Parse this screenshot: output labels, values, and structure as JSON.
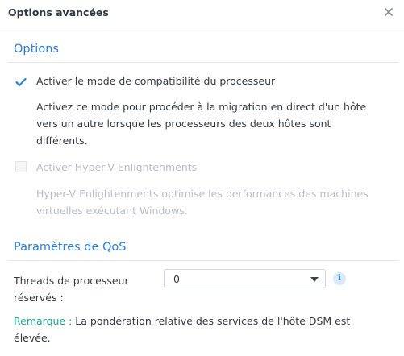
{
  "dialog": {
    "title": "Options avancées",
    "close_icon": "close-icon"
  },
  "options_section": {
    "title": "Options",
    "cpu_compat": {
      "label": "Activer le mode de compatibilité du processeur",
      "checked": true,
      "enabled": true,
      "description_lines": [
        "Activez ce mode pour procéder à la migration en direct d'un hôte",
        "vers un autre lorsque les processeurs des deux hôtes sont",
        "différents."
      ]
    },
    "hyperv": {
      "label": "Activer Hyper-V Enlightenments",
      "checked": false,
      "enabled": false,
      "description_lines": [
        "Hyper-V Enlightenments optimise les performances des machines",
        "virtuelles exécutant Windows."
      ]
    }
  },
  "qos_section": {
    "title": "Paramètres de QoS",
    "threads_label_lines": [
      "Threads de processeur",
      "réservés :"
    ],
    "threads_value": "0",
    "info_icon": "info-icon",
    "note_prefix": "Remarque :",
    "note_text_lines": [
      " La pondération relative des services de l'hôte DSM est",
      "élevée."
    ]
  },
  "colors": {
    "accent": "#2c7fd1",
    "note": "#1fa68b",
    "disabled_text": "#b8bec5"
  }
}
